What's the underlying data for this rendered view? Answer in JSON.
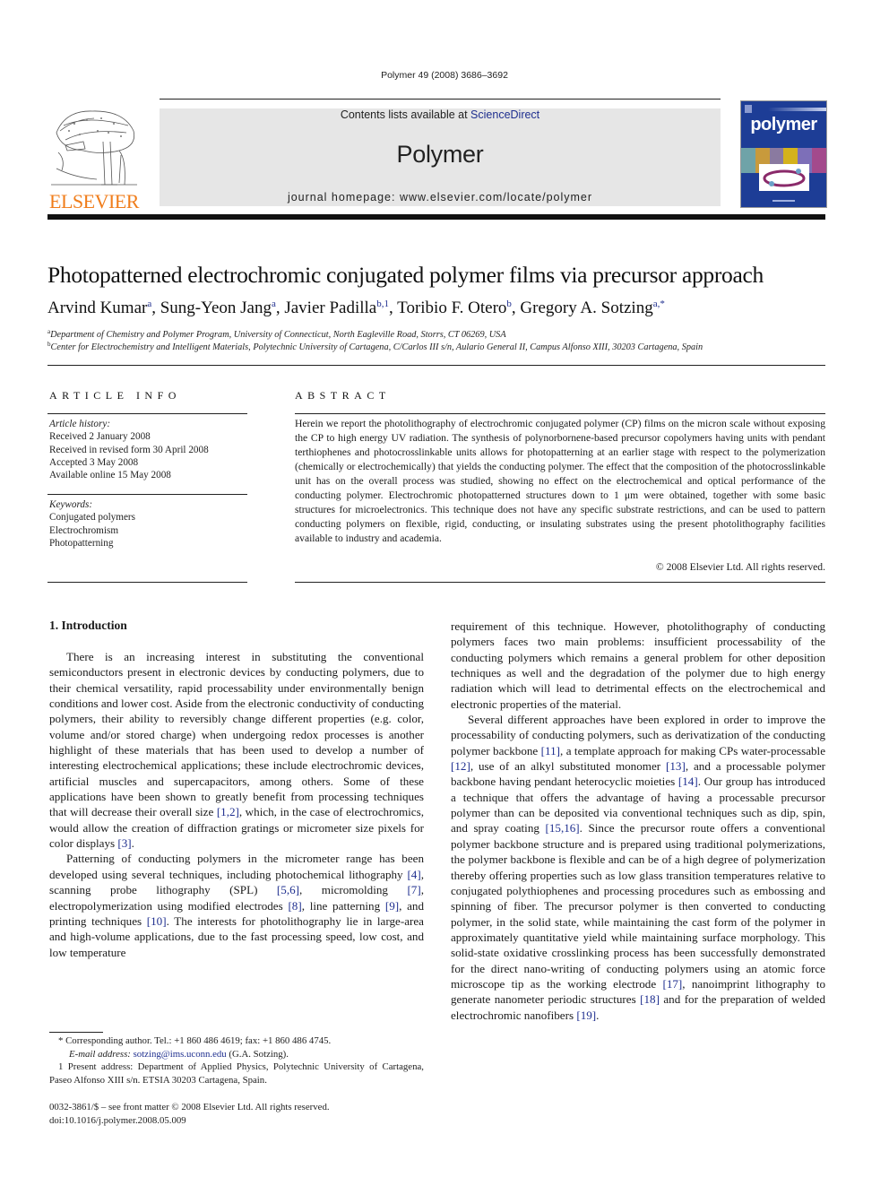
{
  "journal_ref": "Polymer 49 (2008) 3686–3692",
  "header": {
    "publisher_logo_word": "ELSEVIER",
    "contents_prefix": "Contents lists available at ",
    "contents_link": "ScienceDirect",
    "journal_name": "Polymer",
    "homepage": "journal homepage: www.elsevier.com/locate/polymer",
    "cover_title": "polymer",
    "brand_color": "#f07d1b",
    "link_color": "#1f2f8f"
  },
  "article": {
    "title": "Photopatterned electrochromic conjugated polymer films via precursor approach",
    "authors": [
      {
        "name": "Arvind Kumar",
        "sup": "a"
      },
      {
        "name": "Sung-Yeon Jang",
        "sup": "a"
      },
      {
        "name": "Javier Padilla",
        "sup": "b,1"
      },
      {
        "name": "Toribio F. Otero",
        "sup": "b"
      },
      {
        "name": "Gregory A. Sotzing",
        "sup": "a,*"
      }
    ],
    "affiliations": [
      {
        "sup": "a",
        "text": "Department of Chemistry and Polymer Program, University of Connecticut, North Eagleville Road, Storrs, CT 06269, USA"
      },
      {
        "sup": "b",
        "text": "Center for Electrochemistry and Intelligent Materials, Polytechnic University of Cartagena, C/Carlos III s/n, Aulario General II, Campus Alfonso XIII, 30203 Cartagena, Spain"
      }
    ]
  },
  "article_info": {
    "heading": "ARTICLE INFO",
    "history_label": "Article history:",
    "history": [
      "Received 2 January 2008",
      "Received in revised form 30 April 2008",
      "Accepted 3 May 2008",
      "Available online 15 May 2008"
    ],
    "keywords_label": "Keywords:",
    "keywords": [
      "Conjugated polymers",
      "Electrochromism",
      "Photopatterning"
    ]
  },
  "abstract": {
    "heading": "ABSTRACT",
    "text": "Herein we report the photolithography of electrochromic conjugated polymer (CP) films on the micron scale without exposing the CP to high energy UV radiation. The synthesis of polynorbornene-based precursor copolymers having units with pendant terthiophenes and photocrosslinkable units allows for photopatterning at an earlier stage with respect to the polymerization (chemically or electrochemically) that yields the conducting polymer. The effect that the composition of the photocrosslinkable unit has on the overall process was studied, showing no effect on the electrochemical and optical performance of the conducting polymer. Electrochromic photopatterned structures down to 1 μm were obtained, together with some basic structures for microelectronics. This technique does not have any specific substrate restrictions, and can be used to pattern conducting polymers on flexible, rigid, conducting, or insulating substrates using the present photolithography facilities available to industry and academia.",
    "copyright": "© 2008 Elsevier Ltd. All rights reserved."
  },
  "introduction": {
    "heading": "1.  Introduction",
    "p1": [
      {
        "t": "There is an increasing interest in substituting the conventional semiconductors present in electronic devices by conducting polymers, due to their chemical versatility, rapid processability under environmentally benign conditions and lower cost. Aside from the electronic conductivity of conducting polymers, their ability to reversibly change different properties (e.g. color, volume and/or stored charge) when undergoing redox processes is another highlight of these materials that has been used to develop a number of interesting electrochemical applications; these include electrochromic devices, artificial muscles and supercapacitors, among others. Some of these applications have been shown to greatly benefit from processing techniques that will decrease their overall size "
      },
      {
        "c": "[1,2]"
      },
      {
        "t": ", which, in the case of electrochromics, would allow the creation of diffraction gratings or micrometer size pixels for color displays "
      },
      {
        "c": "[3]"
      },
      {
        "t": "."
      }
    ],
    "p2": [
      {
        "t": "Patterning of conducting polymers in the micrometer range has been developed using several techniques, including photochemical lithography "
      },
      {
        "c": "[4]"
      },
      {
        "t": ", scanning probe lithography (SPL) "
      },
      {
        "c": "[5,6]"
      },
      {
        "t": ", micromolding "
      },
      {
        "c": "[7]"
      },
      {
        "t": ", electropolymerization using modified electrodes "
      },
      {
        "c": "[8]"
      },
      {
        "t": ", line patterning "
      },
      {
        "c": "[9]"
      },
      {
        "t": ", and printing techniques "
      },
      {
        "c": "[10]"
      },
      {
        "t": ". The interests for photolithography lie in large-area and high-volume applications, due to the fast processing speed, low cost, and low temperature"
      }
    ],
    "p3": [
      {
        "t": "requirement of this technique. However, photolithography of conducting polymers faces two main problems: insufficient processability of the conducting polymers which remains a general problem for other deposition techniques as well and the degradation of the polymer due to high energy radiation which will lead to detrimental effects on the electrochemical and electronic properties of the material."
      }
    ],
    "p4": [
      {
        "t": "Several different approaches have been explored in order to improve the processability of conducting polymers, such as derivatization of the conducting polymer backbone "
      },
      {
        "c": "[11]"
      },
      {
        "t": ", a template approach for making CPs water-processable "
      },
      {
        "c": "[12]"
      },
      {
        "t": ", use of an alkyl substituted monomer "
      },
      {
        "c": "[13]"
      },
      {
        "t": ", and a processable polymer backbone having pendant heterocyclic moieties "
      },
      {
        "c": "[14]"
      },
      {
        "t": ". Our group has introduced a technique that offers the advantage of having a processable precursor polymer than can be deposited via conventional techniques such as dip, spin, and spray coating "
      },
      {
        "c": "[15,16]"
      },
      {
        "t": ". Since the precursor route offers a conventional polymer backbone structure and is prepared using traditional polymerizations, the polymer backbone is flexible and can be of a high degree of polymerization thereby offering properties such as low glass transition temperatures relative to conjugated polythiophenes and processing procedures such as embossing and spinning of fiber. The precursor polymer is then converted to conducting polymer, in the solid state, while maintaining the cast form of the polymer in approximately quantitative yield while maintaining surface morphology. This solid-state oxidative crosslinking process has been successfully demonstrated for the direct nano-writing of conducting polymers using an atomic force microscope tip as the working electrode "
      },
      {
        "c": "[17]"
      },
      {
        "t": ", nanoimprint lithography to generate nanometer periodic structures "
      },
      {
        "c": "[18]"
      },
      {
        "t": " and for the preparation of welded electrochromic nanofibers "
      },
      {
        "c": "[19]"
      },
      {
        "t": "."
      }
    ]
  },
  "footnotes": {
    "corresponding": "* Corresponding author. Tel.: +1 860 486 4619; fax: +1 860 486 4745.",
    "email_label": "E-mail address: ",
    "email": "sotzing@ims.uconn.edu",
    "email_suffix": " (G.A. Sotzing).",
    "present_address": "1  Present address: Department of Applied Physics, Polytechnic University of Cartagena, Paseo Alfonso XIII s/n. ETSIA 30203 Cartagena, Spain."
  },
  "bottom": {
    "issn_line": "0032-3861/$ – see front matter © 2008 Elsevier Ltd. All rights reserved.",
    "doi": "doi:10.1016/j.polymer.2008.05.009"
  }
}
